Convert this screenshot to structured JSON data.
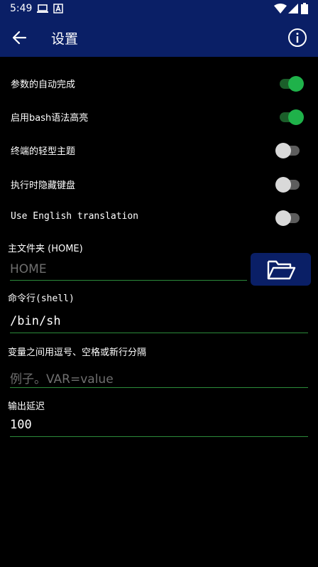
{
  "status_bar": {
    "time": "5:49"
  },
  "app_bar": {
    "title": "设置"
  },
  "toggles": [
    {
      "label": "参数的自动完成",
      "on": true
    },
    {
      "label": "启用bash语法高亮",
      "on": true
    },
    {
      "label": "终端的轻型主题",
      "on": false
    },
    {
      "label": "执行时隐藏键盘",
      "on": false
    },
    {
      "label": "Use English translation",
      "on": false
    }
  ],
  "home": {
    "label": "主文件夹 (HOME)",
    "placeholder": "HOME",
    "value": ""
  },
  "shell": {
    "label": "命令行(shell)",
    "value": "/bin/sh"
  },
  "env": {
    "label": "变量之间用逗号、空格或新行分隔",
    "placeholder": "例子。VAR=value",
    "value": ""
  },
  "output_delay": {
    "label": "输出延迟",
    "value": "100"
  },
  "colors": {
    "app_bar": "#0a1f66",
    "switch_on": "#1fb24a",
    "underline": "#2b8b3a"
  }
}
